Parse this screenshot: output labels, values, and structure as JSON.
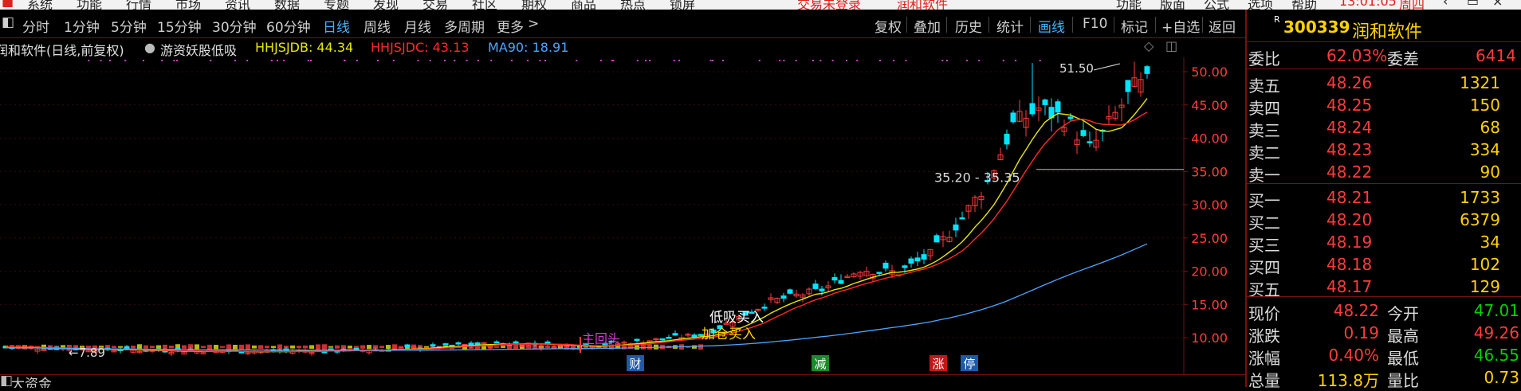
{
  "top_menu": {
    "items": [
      "系统",
      "功能",
      "行情",
      "市场",
      "资讯",
      "数据",
      "专题",
      "发现",
      "交易",
      "社区",
      "期权",
      "商品",
      "热点",
      "锁屏"
    ],
    "alert": "交易未登录",
    "stock_red": "润和软件",
    "right_items": [
      "功能",
      "版面",
      "公式",
      "选项",
      "帮助"
    ],
    "time": "13:01:05",
    "weekday": "周四"
  },
  "toolbar": {
    "left": [
      "分时",
      "1分钟",
      "5分钟",
      "15分钟",
      "30分钟",
      "60分钟",
      "日线",
      "周线",
      "月线",
      "多周期",
      "更多"
    ],
    "more_arrow": ">",
    "active": "日线",
    "right": [
      "复权",
      "叠加",
      "历史",
      "统计",
      "画线",
      "F10",
      "标记",
      "+自选",
      "返回"
    ],
    "right_active": "画线"
  },
  "legend": {
    "title": "润和软件(日线,前复权)",
    "indicator": "游资妖股低吸",
    "hhjsjdb": "HHJSJDB: 44.34",
    "hhjsjdc": "HHJSJDC: 43.13",
    "ma90": "MA90: 18.91",
    "colors": {
      "hhjsjdb": "#e8e800",
      "hhjsjdc": "#ff2a2a",
      "ma90": "#4da6ff"
    }
  },
  "chart_data": {
    "type": "candlestick",
    "y_axis_ticks": [
      "50.00",
      "45.00",
      "40.00",
      "35.00",
      "30.00",
      "25.00",
      "20.00",
      "15.00",
      "10.00"
    ],
    "ylim": [
      7,
      55
    ],
    "annotations": {
      "high_label": "51.50",
      "range_label": "35.20 - 35.35",
      "low_label": "7.89",
      "signal_1": "低吸买入",
      "signal_2": "加仓买入",
      "signal_3": "主回头"
    },
    "markers": [
      "财",
      "减",
      "涨",
      "停"
    ],
    "colors": {
      "up": "#ff3b3b",
      "down": "#00e5ff",
      "ma_yellow": "#e8e800",
      "ma_red": "#ff2a2a",
      "ma_blue": "#4da6ff"
    }
  },
  "quote_panel": {
    "code": "300339",
    "name": "润和软件",
    "r_mark": "R",
    "weibi_label": "委比",
    "weibi_value": "62.03%",
    "weicha_label": "委差",
    "weicha_value": "6414",
    "asks": [
      {
        "label": "卖五",
        "price": "48.26",
        "vol": "1321"
      },
      {
        "label": "卖四",
        "price": "48.25",
        "vol": "150"
      },
      {
        "label": "卖三",
        "price": "48.24",
        "vol": "68"
      },
      {
        "label": "卖二",
        "price": "48.23",
        "vol": "334"
      },
      {
        "label": "卖一",
        "price": "48.22",
        "vol": "90"
      }
    ],
    "bids": [
      {
        "label": "买一",
        "price": "48.21",
        "vol": "1733"
      },
      {
        "label": "买二",
        "price": "48.20",
        "vol": "6379"
      },
      {
        "label": "买三",
        "price": "48.19",
        "vol": "34"
      },
      {
        "label": "买四",
        "price": "48.18",
        "vol": "102"
      },
      {
        "label": "买五",
        "price": "48.17",
        "vol": "129"
      }
    ],
    "stats": [
      {
        "l1": "现价",
        "v1": "48.22",
        "l2": "今开",
        "v2": "47.01"
      },
      {
        "l1": "涨跌",
        "v1": "0.19",
        "l2": "最高",
        "v2": "49.26"
      },
      {
        "l1": "涨幅",
        "v1": "0.40%",
        "l2": "最低",
        "v2": "46.55"
      },
      {
        "l1": "总量",
        "v1": "113.8万",
        "l2": "量比",
        "v2": "0.73"
      }
    ]
  },
  "bottom_panel": {
    "title": "大资金"
  }
}
